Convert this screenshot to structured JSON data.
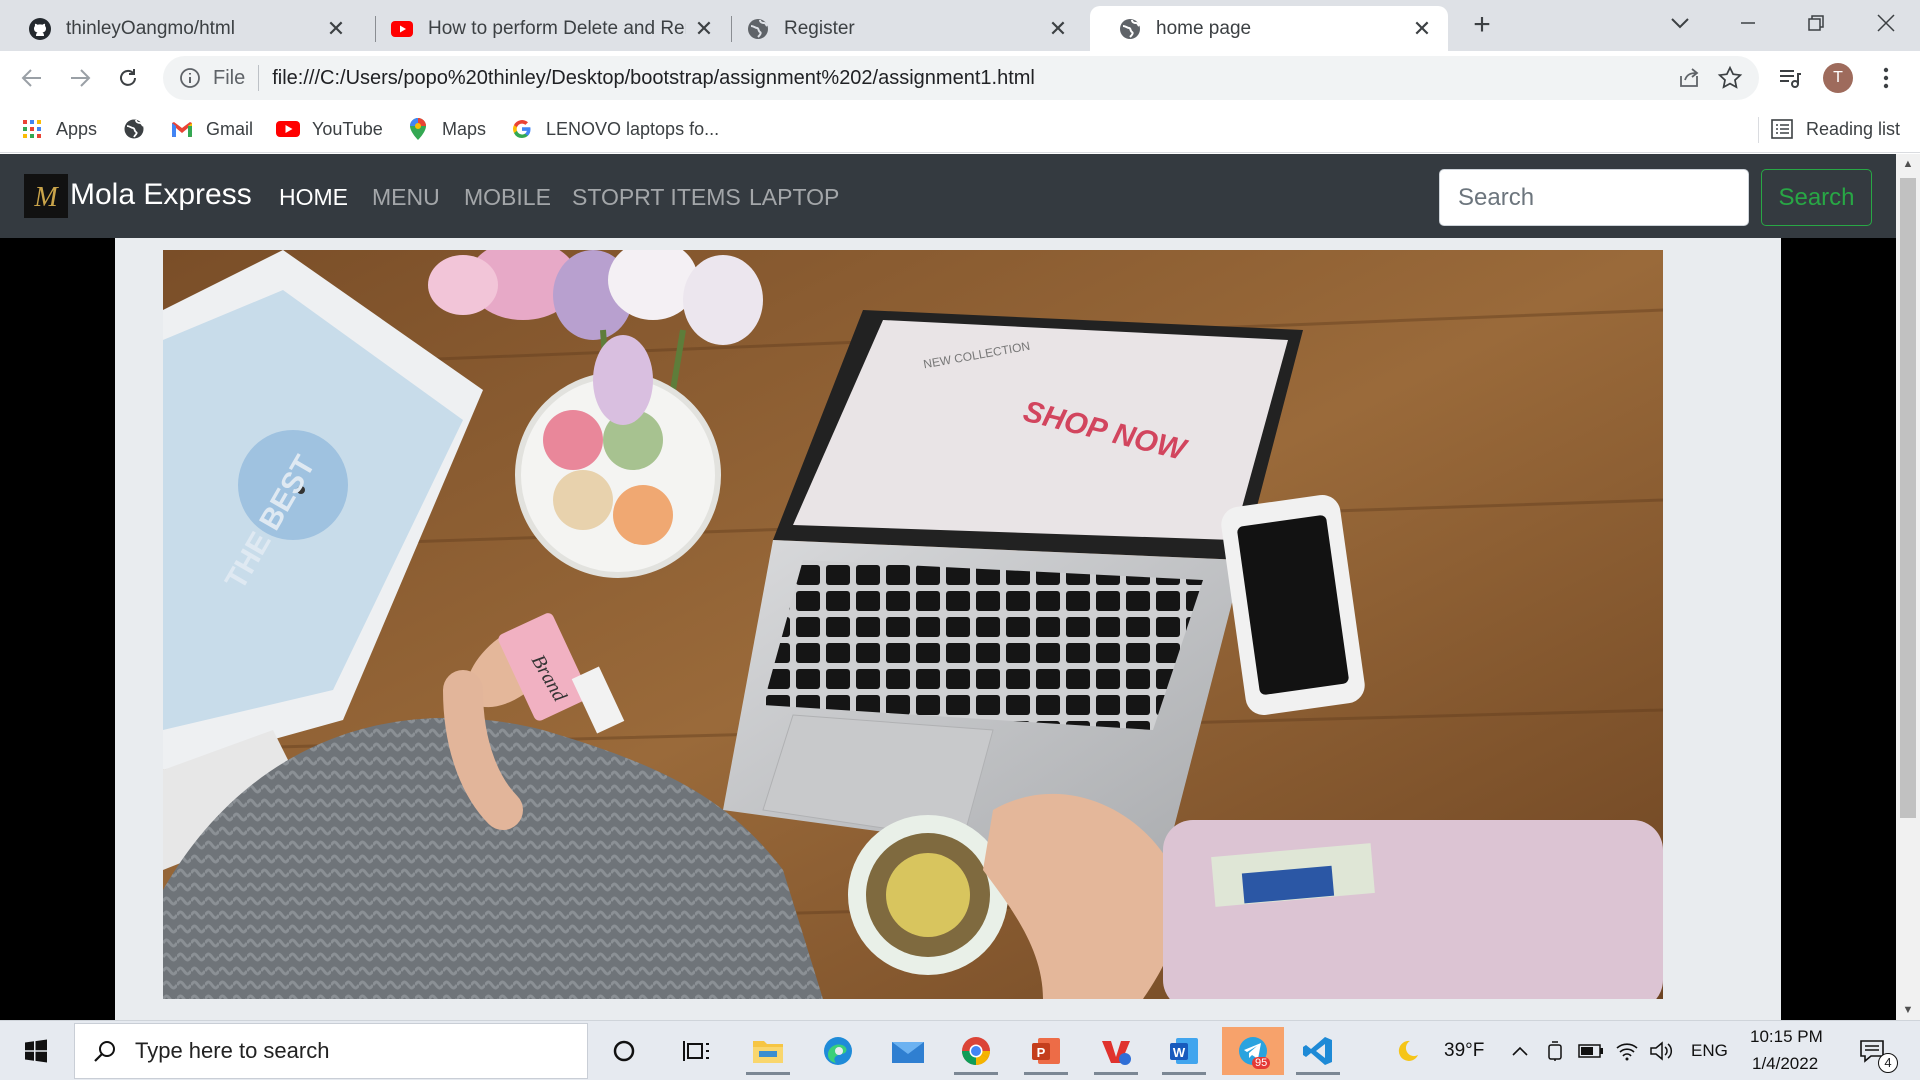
{
  "browser": {
    "tabs": [
      {
        "title": "thinleyOangmo/html",
        "icon": "github-icon",
        "active": false
      },
      {
        "title": "How to perform Delete and Rem",
        "icon": "youtube-icon",
        "active": false
      },
      {
        "title": "Register",
        "icon": "globe-icon",
        "active": false
      },
      {
        "title": "home page",
        "icon": "globe-icon",
        "active": true
      }
    ],
    "address": {
      "scheme_label": "File",
      "url": "file:///C:/Users/popo%20thinley/Desktop/bootstrap/assignment%202/assignment1.html"
    },
    "profile_initial": "T",
    "bookmarks": [
      {
        "label": "Apps",
        "icon": "apps-grid-icon"
      },
      {
        "label": "",
        "icon": "globe-icon"
      },
      {
        "label": "Gmail",
        "icon": "gmail-icon"
      },
      {
        "label": "YouTube",
        "icon": "youtube-icon"
      },
      {
        "label": "Maps",
        "icon": "maps-pin-icon"
      },
      {
        "label": "LENOVO laptops fo...",
        "icon": "google-icon"
      }
    ],
    "reading_list": "Reading list"
  },
  "site": {
    "brand_logo": "M",
    "brand_name": "Mola Express",
    "nav": [
      {
        "label": "HOME",
        "active": true
      },
      {
        "label": "MENU",
        "active": false
      },
      {
        "label": "MOBILE",
        "active": false
      },
      {
        "label": "STOPRT ITEMS",
        "active": false
      },
      {
        "label": "LAPTOP",
        "active": false
      }
    ],
    "search_placeholder": "Search",
    "search_button": "Search",
    "hero": {
      "screen_headline": "SHOP NOW",
      "screen_small": "NEW COLLECTION",
      "tag_text": "Brand",
      "magazine_text": "THE BEST"
    }
  },
  "taskbar": {
    "search_placeholder": "Type here to search",
    "weather": "39°F",
    "language": "ENG",
    "time": "10:15 PM",
    "date": "1/4/2022",
    "notifications": "4",
    "telegram_badge": "95"
  },
  "colors": {
    "navbar": "#343a40",
    "success": "#28a745",
    "content_bg": "#e9ecef"
  }
}
